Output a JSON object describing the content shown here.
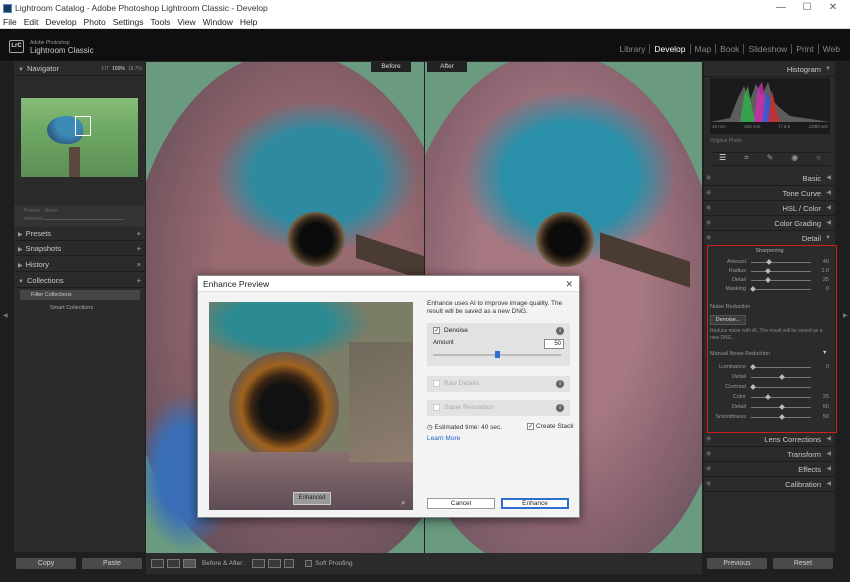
{
  "window": {
    "title": "Lightroom Catalog - Adobe Photoshop Lightroom Classic - Develop",
    "controls": [
      "—",
      "☐",
      "✕"
    ]
  },
  "menu": [
    "File",
    "Edit",
    "Develop",
    "Photo",
    "Settings",
    "Tools",
    "View",
    "Window",
    "Help"
  ],
  "identity": {
    "logo": "LrC",
    "line1": "Adobe Photoshop",
    "line2": "Lightroom Classic"
  },
  "modules": [
    "Library",
    "Develop",
    "Map",
    "Book",
    "Slideshow",
    "Print",
    "Web"
  ],
  "navigator": {
    "title": "Navigator",
    "zoom": [
      "FIT",
      "100%",
      "18.7%"
    ]
  },
  "left_faint": {
    "preset": "Preset : None",
    "amount": "Amount"
  },
  "left_panels": [
    {
      "label": "Presets"
    },
    {
      "label": "Snapshots"
    },
    {
      "label": "History"
    },
    {
      "label": "Collections"
    }
  ],
  "collections": [
    "Filter Collections",
    "Smart Collections"
  ],
  "left_buttons": {
    "copy": "Copy",
    "paste": "Paste"
  },
  "view": {
    "before": "Before",
    "after": "After"
  },
  "toolbar": {
    "mode": "Before & After :",
    "soft": "Soft Proofing"
  },
  "histogram": {
    "title": "Histogram",
    "exif": [
      "10 mm",
      "200 mm",
      "f / 5.6",
      "1/800 sec"
    ],
    "original": "Original Photo"
  },
  "right_sections": [
    {
      "label": "Basic"
    },
    {
      "label": "Tone Curve"
    },
    {
      "label": "HSL / Color"
    },
    {
      "label": "Color Grading"
    },
    {
      "label": "Detail"
    }
  ],
  "sharpening": {
    "title": "Sharpening",
    "sliders": [
      {
        "label": "Amount",
        "value": "40",
        "pos": 0.27
      },
      {
        "label": "Radius",
        "value": "1.0",
        "pos": 0.25
      },
      {
        "label": "Detail",
        "value": "25",
        "pos": 0.25
      },
      {
        "label": "Masking",
        "value": "0",
        "pos": 0.0
      }
    ]
  },
  "noise": {
    "title": "Noise Reduction",
    "denoise_btn": "Denoise...",
    "desc": "Reduce noise with AI. The result will be saved as a new DNG.",
    "manual": "Manual Noise Reduction",
    "sliders": [
      {
        "label": "Luminance",
        "value": "0",
        "pos": 0.0
      },
      {
        "label": "Detail",
        "value": "",
        "pos": 0.5
      },
      {
        "label": "Contrast",
        "value": "",
        "pos": 0.0
      },
      {
        "label": "Color",
        "value": "25",
        "pos": 0.25
      },
      {
        "label": "Detail",
        "value": "50",
        "pos": 0.5
      },
      {
        "label": "Smoothness",
        "value": "50",
        "pos": 0.5
      }
    ]
  },
  "right_sections2": [
    {
      "label": "Lens Corrections"
    },
    {
      "label": "Transform"
    },
    {
      "label": "Effects"
    },
    {
      "label": "Calibration"
    }
  ],
  "right_buttons": {
    "previous": "Previous",
    "reset": "Reset"
  },
  "dialog": {
    "title": "Enhance Preview",
    "desc": "Enhance uses AI to improve image quality. The result will be saved as a new DNG.",
    "denoise": "Denoise",
    "amount_label": "Amount",
    "amount_value": "50",
    "amount_fraction": 0.5,
    "raw_details": "Raw Details",
    "super_resolution": "Super Resolution",
    "estimate": "Estimated time: 40 sec.",
    "create_stack": "Create Stack",
    "learn_more": "Learn More",
    "cancel": "Cancel",
    "enhance": "Enhance",
    "preview_badge": "Enhanced"
  },
  "colors": {
    "accent_red": "#d21f1f",
    "link_blue": "#1a62c9",
    "enhance_border": "#2d6fd1"
  }
}
